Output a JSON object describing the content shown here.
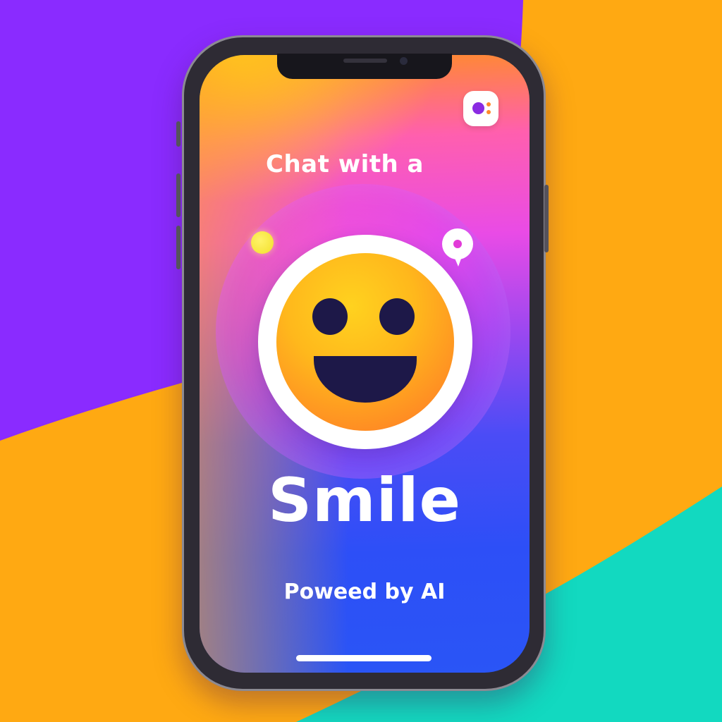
{
  "screen": {
    "headline": "Chat with a",
    "brand": "Smile",
    "tagline": "Poweed by AI"
  },
  "icons": {
    "app_badge": "app-logo-icon",
    "smiley": "smiley-face-icon",
    "orb": "yellow-orb-icon",
    "chat": "chat-bubble-icon"
  },
  "colors": {
    "background_purple": "#8A2BFF",
    "background_orange": "#FFA912",
    "background_teal": "#12D9C0",
    "screen_top": "#FF8C2A",
    "screen_mid": "#E94BE6",
    "screen_bottom": "#2A55F6",
    "face": "#FFB81C",
    "face_features": "#1D1848",
    "text": "#FFFFFF"
  }
}
